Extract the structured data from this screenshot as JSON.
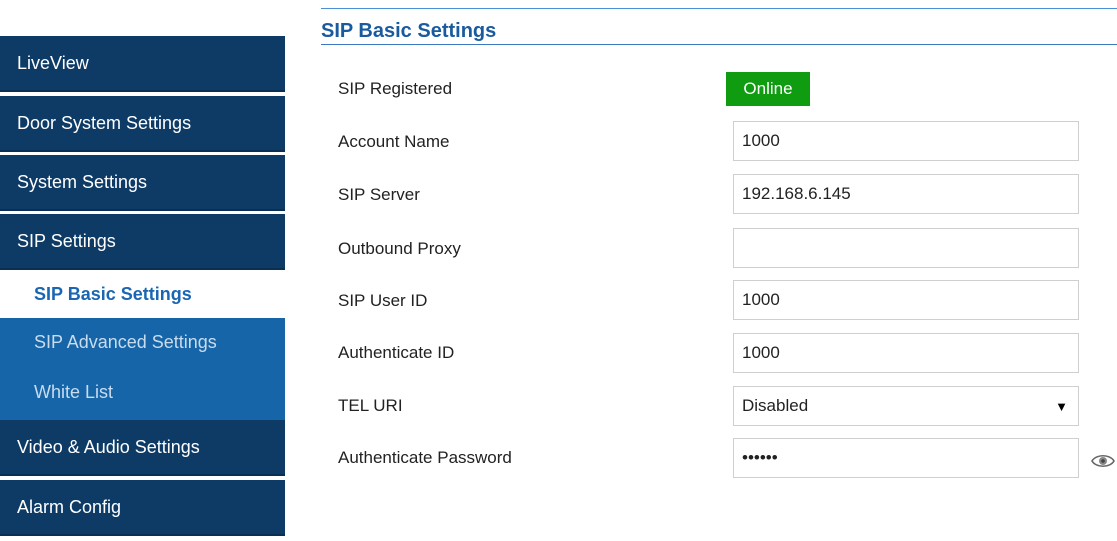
{
  "sidebar": {
    "items": [
      {
        "label": "LiveView"
      },
      {
        "label": "Door System Settings"
      },
      {
        "label": "System Settings"
      },
      {
        "label": "SIP Settings"
      },
      {
        "label": "Video & Audio Settings"
      },
      {
        "label": "Alarm Config"
      }
    ],
    "sub_items": [
      {
        "label": "SIP Basic Settings",
        "active": true
      },
      {
        "label": "SIP Advanced Settings"
      },
      {
        "label": "White List"
      }
    ]
  },
  "main": {
    "title": "SIP Basic Settings",
    "sip_registered": {
      "label": "SIP Registered",
      "status": "Online"
    },
    "account_name": {
      "label": "Account Name",
      "value": "1000"
    },
    "sip_server": {
      "label": "SIP Server",
      "value": "192.168.6.145"
    },
    "outbound_proxy": {
      "label": "Outbound Proxy",
      "value": ""
    },
    "sip_user_id": {
      "label": "SIP User ID",
      "value": "1000"
    },
    "authenticate_id": {
      "label": "Authenticate ID",
      "value": "1000"
    },
    "tel_uri": {
      "label": "TEL URI",
      "value": "Disabled"
    },
    "authenticate_password": {
      "label": "Authenticate Password",
      "value": "••••••"
    }
  },
  "icons": {
    "password_toggle": "eye-icon"
  },
  "colors": {
    "nav_bg": "#0d3b66",
    "sub_bg": "#1565a8",
    "accent": "#1a66b3",
    "online": "#109c10"
  }
}
